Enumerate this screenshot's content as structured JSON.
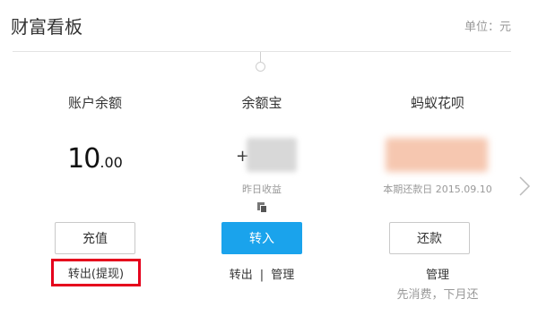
{
  "header": {
    "title": "财富看板",
    "unit": "单位：元"
  },
  "account": {
    "title": "账户余额",
    "balance_int": "10",
    "balance_dec": ".00",
    "recharge_label": "充值",
    "withdraw_label": "转出(提现)"
  },
  "yuebao": {
    "title": "余额宝",
    "plus": "+",
    "caption": "昨日收益",
    "transfer_in_label": "转入",
    "transfer_out_label": "转出",
    "separator": "|",
    "manage_label": "管理"
  },
  "huabei": {
    "title": "蚂蚁花呗",
    "due_caption": "本期还款日 2015.09.10",
    "repay_label": "还款",
    "manage_label": "管理",
    "hint": "先消费，下月还"
  },
  "colors": {
    "primary": "#1aa3ec",
    "highlight": "#e5001c"
  },
  "icons": {
    "copy": "copy-icon",
    "next": "chevron-right-icon"
  }
}
